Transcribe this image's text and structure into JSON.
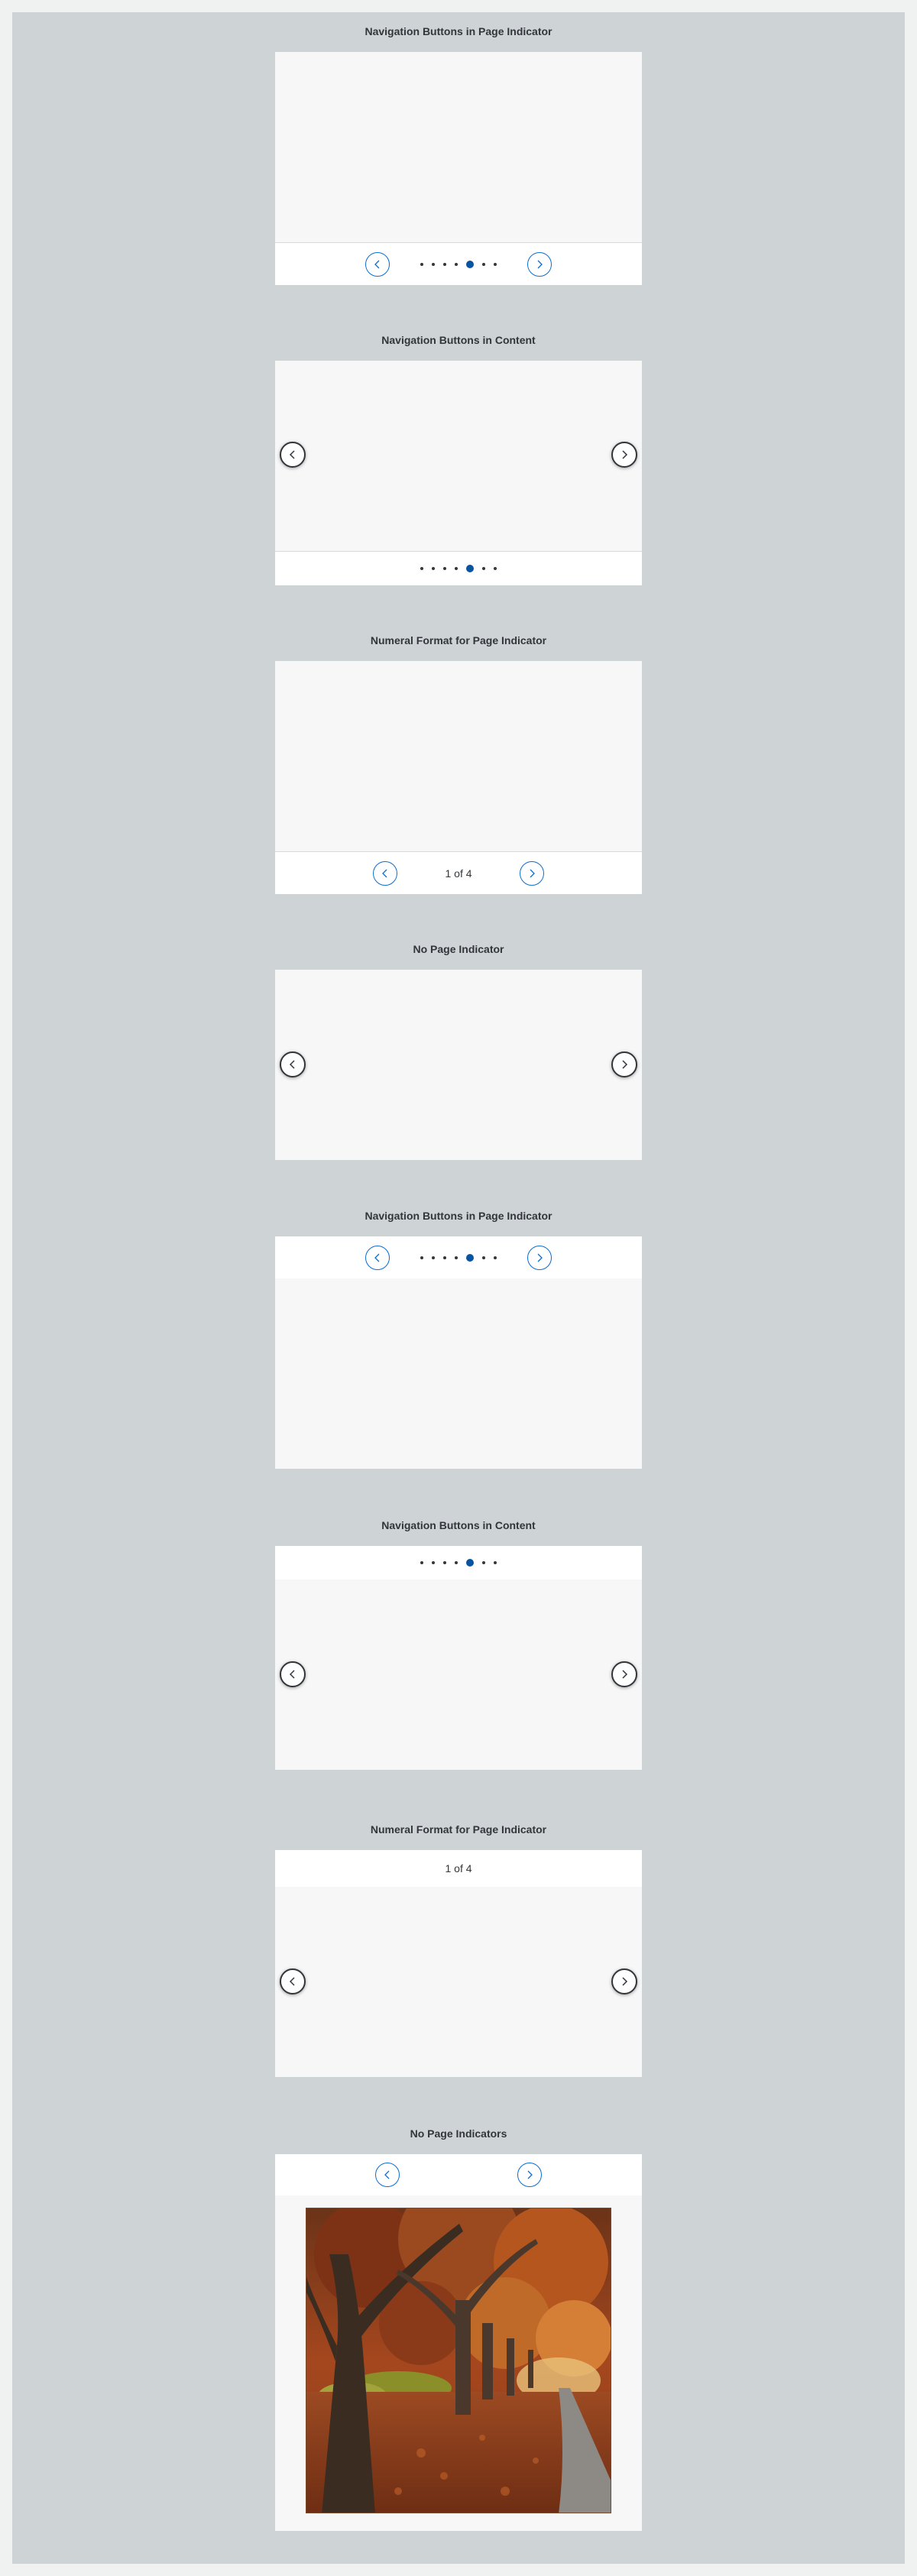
{
  "sections": [
    {
      "title": "Navigation Buttons in Page Indicator",
      "indicator_type": "dots",
      "indicator_position": "bottom",
      "buttons": "indicator",
      "dot_count": 7,
      "active_dot": 5
    },
    {
      "title": "Navigation Buttons in Content",
      "indicator_type": "dots",
      "indicator_position": "bottom",
      "buttons": "content",
      "dot_count": 7,
      "active_dot": 5
    },
    {
      "title": "Numeral Format for Page Indicator",
      "indicator_type": "numeral",
      "indicator_position": "bottom",
      "buttons": "indicator",
      "numeral_text": "1 of 4"
    },
    {
      "title": "No Page Indicator",
      "indicator_type": "none",
      "buttons": "content"
    },
    {
      "title": "Navigation Buttons in Page Indicator",
      "indicator_type": "dots",
      "indicator_position": "top",
      "buttons": "indicator",
      "dot_count": 7,
      "active_dot": 5
    },
    {
      "title": "Navigation Buttons in Content",
      "indicator_type": "dots",
      "indicator_position": "top",
      "buttons": "content",
      "dot_count": 7,
      "active_dot": 5
    },
    {
      "title": "Numeral Format for Page Indicator",
      "indicator_type": "numeral",
      "indicator_position": "top",
      "buttons": "content",
      "numeral_text": "1 of 4"
    },
    {
      "title": "No Page Indicators",
      "indicator_type": "buttons-only",
      "indicator_position": "top",
      "buttons": "indicator",
      "has_image": true
    }
  ],
  "icons": {
    "prev": "chevron-left-icon",
    "next": "chevron-right-icon"
  },
  "colors": {
    "accent": "#0a6ed1",
    "active_dot": "#0854a0",
    "background": "#ced4d5",
    "content": "#f7f7f7"
  }
}
